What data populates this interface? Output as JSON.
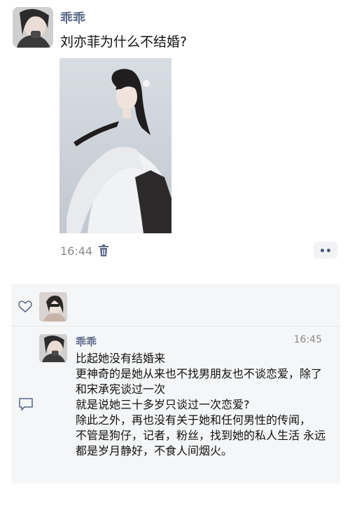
{
  "post": {
    "username": "乖乖",
    "text": "刘亦菲为什么不结婚?",
    "time": "16:44"
  },
  "comment": {
    "username": "乖乖",
    "time": "16:45",
    "lines": [
      "比起她没有结婚来",
      "更神奇的是她从来也不找男朋友也不谈恋爱，除了和宋承宪谈过一次",
      "就是说她三十多岁只谈过一次恋爱?",
      "除此之外，再也没有关于她和任何男性的传闻，",
      "不管是狗仔，记者，粉丝，找到她的私人生活 永远都是岁月静好，不食人间烟火。"
    ]
  },
  "colors": {
    "name": "#5b6a8a",
    "meta": "#8a8a8a",
    "comments_bg": "#f5f6f7"
  },
  "icons": {
    "delete": "trash-icon",
    "more": "more-dots-icon",
    "like": "heart-icon",
    "comment": "comment-icon"
  }
}
